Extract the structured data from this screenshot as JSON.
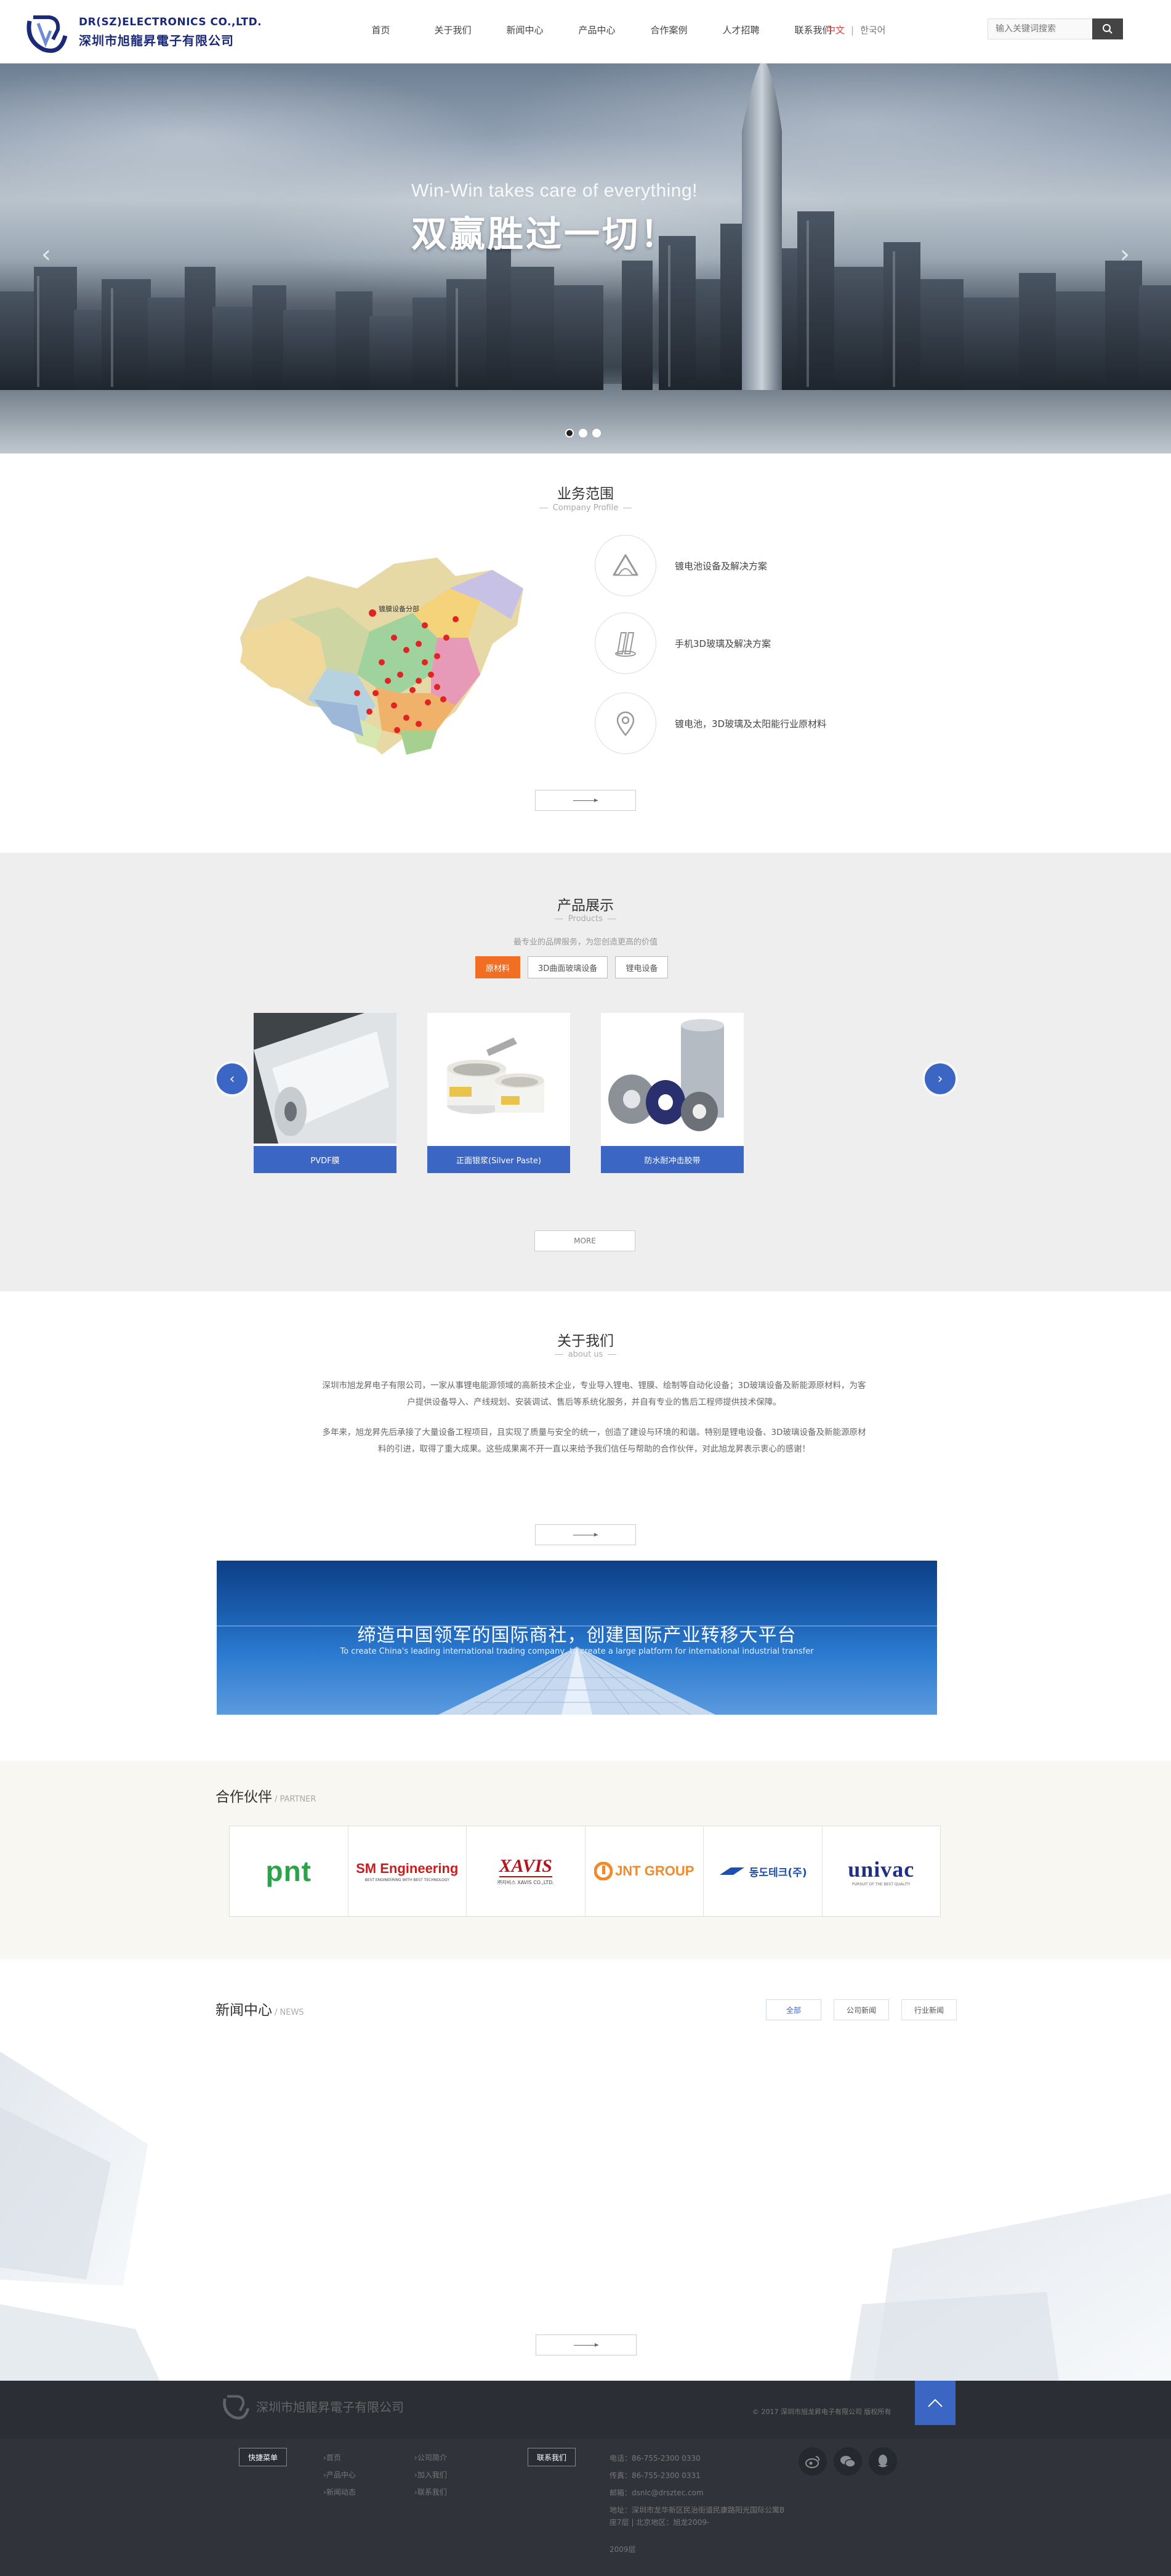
{
  "header": {
    "logo_en": "DR(SZ)ELECTRONICS CO.,LTD.",
    "logo_cn": "深圳市旭龍昇電子有限公司",
    "nav": [
      "首页",
      "关于我们",
      "新闻中心",
      "产品中心",
      "合作案例",
      "人才招聘",
      "联系我们"
    ],
    "lang_current": "中文",
    "lang_separator": "|",
    "lang_other": "한국어",
    "search_placeholder": "输入关键词搜索"
  },
  "banner": {
    "headline_en": "Win-Win takes care of everything!",
    "headline_cn": "双赢胜过一切！",
    "slides": 3,
    "active_slide": 1
  },
  "business": {
    "title": "业务范围",
    "subtitle": "Company Profile",
    "map_label": "镀膜设备分部",
    "items": [
      {
        "icon": "triangle-icon",
        "label": "镀电池设备及解决方案"
      },
      {
        "icon": "glass-icon",
        "label": "手机3D玻璃及解决方案"
      },
      {
        "icon": "location-pin-icon",
        "label": "镀电池，3D玻璃及太阳能行业原材料"
      }
    ]
  },
  "products": {
    "title": "产品展示",
    "subtitle": "Products",
    "desc": "最专业的品牌服务，为您创造更高的价值",
    "tabs": [
      "原材料",
      "3D曲面玻璃设备",
      "锂电设备"
    ],
    "active_tab": 0,
    "items": [
      {
        "name": "PVDF膜"
      },
      {
        "name": "正面银浆(Silver Paste)"
      },
      {
        "name": "防水耐冲击胶带"
      }
    ],
    "more_label": "MORE"
  },
  "about": {
    "title": "关于我们",
    "subtitle": "about us",
    "p1": "深圳市旭龙昇电子有限公司，一家从事锂电能源领域的高新技术企业，专业导入锂电、锂膜、绘制等自动化设备；3D玻璃设备及新能源原材料，为客户提供设备导入、产线规划、安装调试、售后等系统化服务，并自有专业的售后工程师提供技术保障。",
    "p2": "多年来，旭龙昇先后承接了大量设备工程项目，且实现了质量与安全的统一，创造了建设与环境的和谐。特别是锂电设备、3D玻璃设备及新能源原材料的引进，取得了重大成果。这些成果离不开一直以来给予我们信任与帮助的合作伙伴，对此旭龙昇表示衷心的感谢！",
    "slogan_cn": "缔造中国领军的国际商社，创建国际产业转移大平台",
    "slogan_en": "To create China's leading international trading company, to create a large platform for international industrial transfer"
  },
  "partners": {
    "title": "合作伙伴",
    "subtitle": "/ PARTNER",
    "logos": [
      {
        "name": "pnt",
        "text": "pnt"
      },
      {
        "name": "sm-engineering",
        "text": "SM Engineering",
        "sub": "BEST ENGINEERING WITH BEST TECHNOLOGY"
      },
      {
        "name": "xavis",
        "text": "XAVIS",
        "sub": "㈜자비스 XAVIS CO.,LTD."
      },
      {
        "name": "jnt-group",
        "text": "JNT GROUP"
      },
      {
        "name": "dongdo-tech",
        "text": "동도테크(주)"
      },
      {
        "name": "univac",
        "text": "univac",
        "sub": "PURSUIT OF THE BEST QUALITY"
      }
    ]
  },
  "news": {
    "title": "新闻中心",
    "subtitle": "/ NEWS",
    "tabs": [
      "全部",
      "公司新闻",
      "行业新闻"
    ],
    "active_tab": 0
  },
  "footer": {
    "logo_text": "深圳市旭龍昇電子有限公司",
    "copyright": "© 2017 深圳市旭龙昇电子有限公司 版权所有",
    "quick_menu_label": "快捷菜单",
    "quick_links": [
      "首页",
      "产品中心",
      "新闻动态",
      "公司简介",
      "加入我们",
      "联系我们"
    ],
    "contact_label": "联系我们",
    "contact": [
      "电话：86-755-2300 0330",
      "传真：86-755-2300 0331",
      "邮箱：dsnlc@drsztec.com",
      "地址：深圳市龙华新区民治街道民康路阳光国际公寓B座7层 | 北京地区：旭龙2009-",
      "2009层"
    ],
    "colors": {
      "accent": "#3c66c4",
      "orange": "#f26e22"
    }
  }
}
